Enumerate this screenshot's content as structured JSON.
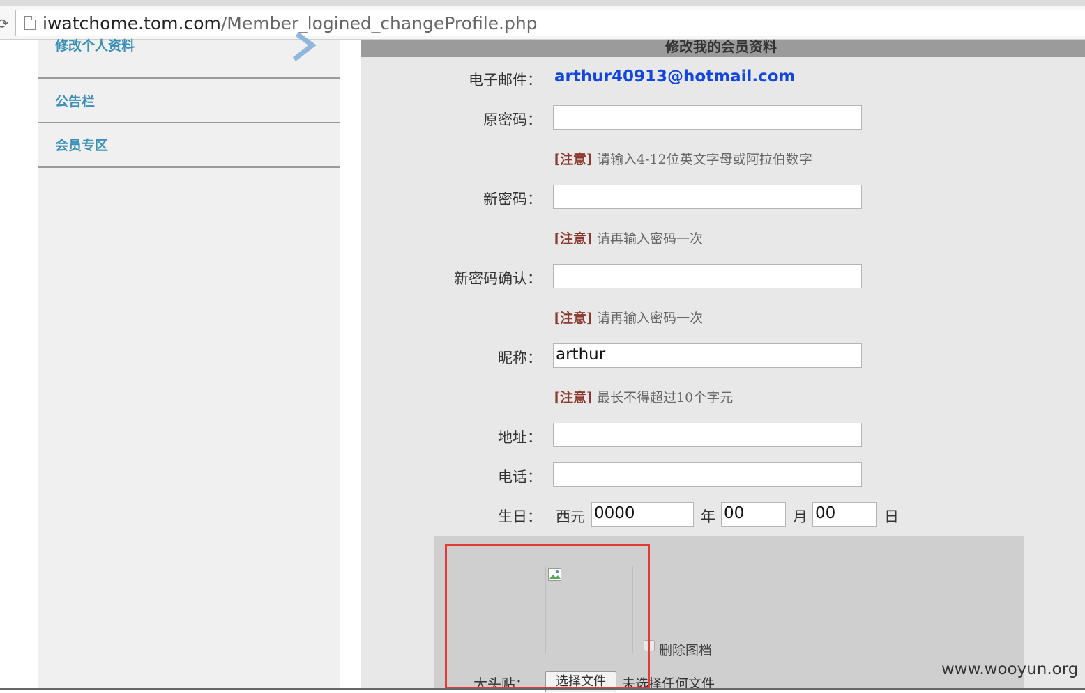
{
  "browser": {
    "url_host": "iwatchome.tom.com",
    "url_path": "/Member_logined_changeProfile.php"
  },
  "sidebar": {
    "items": [
      {
        "label": "修改个人资料"
      },
      {
        "label": "公告栏"
      },
      {
        "label": "会员专区"
      }
    ]
  },
  "form": {
    "header": "修改我的会员资料",
    "email_label": "电子邮件：",
    "email_value": "arthur40913@hotmail.com",
    "old_password_label": "原密码：",
    "note_tag": "[注意]",
    "old_password_note": "请输入4-12位英文字母或阿拉伯数字",
    "new_password_label": "新密码：",
    "new_password_note": "请再输入密码一次",
    "confirm_password_label": "新密码确认：",
    "confirm_password_note": "请再输入密码一次",
    "nickname_label": "昵称：",
    "nickname_value": "arthur",
    "nickname_note": "最长不得超过10个字元",
    "address_label": "地址：",
    "phone_label": "电话：",
    "birthday_label": "生日：",
    "birthday_era": "西元",
    "birthday_year": "0000",
    "year_unit": "年",
    "birthday_month": "00",
    "month_unit": "月",
    "birthday_day": "00",
    "day_unit": "日",
    "delete_image_label": "删除图档",
    "avatar_label": "大头贴：",
    "choose_file_button": "选择文件",
    "no_file_text": "未选择任何文件"
  },
  "watermark": "www.wooyun.org",
  "colors": {
    "link_blue": "#1246e0",
    "sidebar_text": "#3a8fb7",
    "note_red": "#8b3a2f",
    "highlight_red": "#e53935"
  }
}
